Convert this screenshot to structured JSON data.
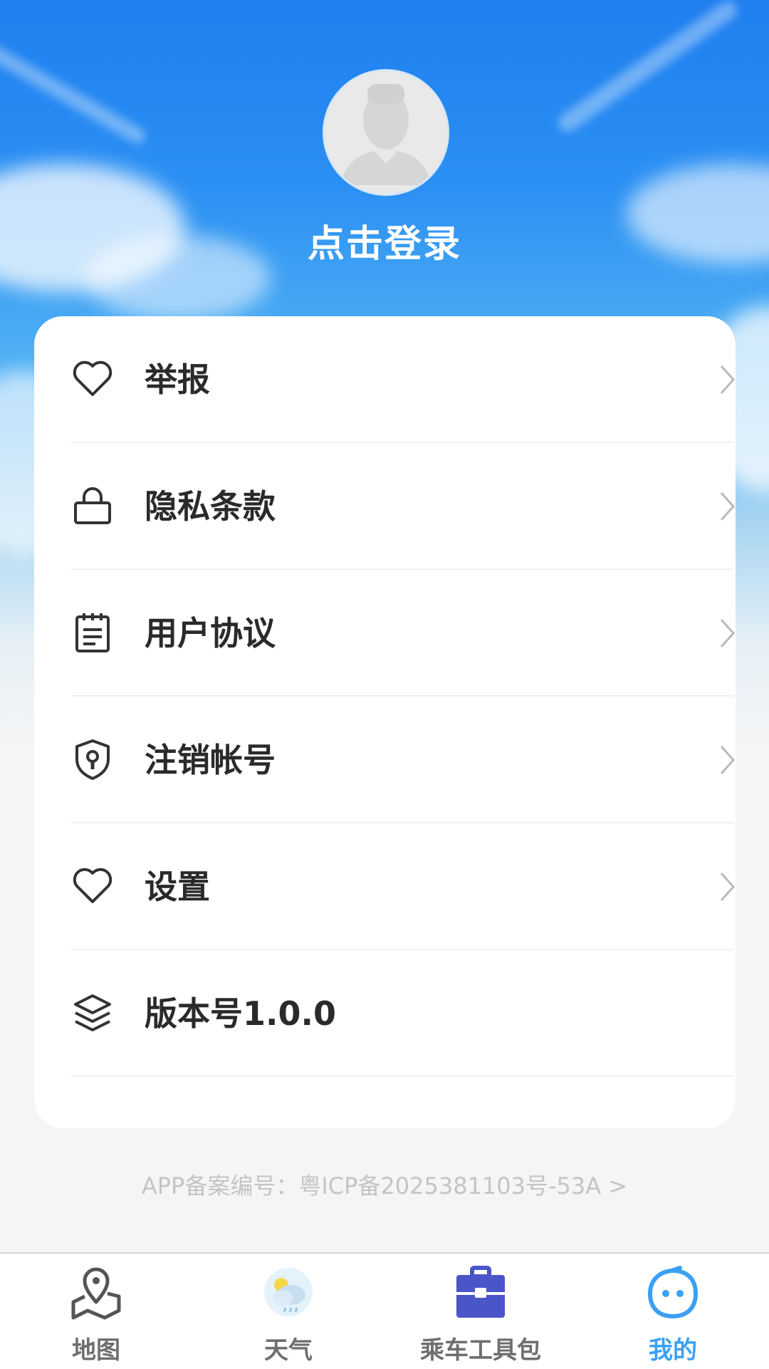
{
  "profile": {
    "login_text": "点击登录"
  },
  "menu": [
    {
      "label": "举报",
      "icon": "heart-icon",
      "has_arrow": true
    },
    {
      "label": "隐私条款",
      "icon": "lock-icon",
      "has_arrow": true
    },
    {
      "label": "用户协议",
      "icon": "notepad-icon",
      "has_arrow": true
    },
    {
      "label": "注销帐号",
      "icon": "shield-key-icon",
      "has_arrow": true
    },
    {
      "label": "设置",
      "icon": "heart-icon",
      "has_arrow": true
    },
    {
      "label": "版本号1.0.0",
      "icon": "layers-icon",
      "has_arrow": false
    }
  ],
  "footer": {
    "icp_text": "APP备案编号：粤ICP备2025381103号-53A >"
  },
  "tabbar": {
    "tabs": [
      {
        "label": "地图",
        "icon": "map-pin-icon",
        "active": false
      },
      {
        "label": "天气",
        "icon": "weather-icon",
        "active": false
      },
      {
        "label": "乘车工具包",
        "icon": "toolbox-icon",
        "active": false
      },
      {
        "label": "我的",
        "icon": "smiley-bubble-icon",
        "active": true
      }
    ]
  },
  "colors": {
    "accent": "#3ba0f4",
    "toolbox": "#4a55c8",
    "text": "#2a2a2a",
    "muted": "#c4c4c4"
  }
}
